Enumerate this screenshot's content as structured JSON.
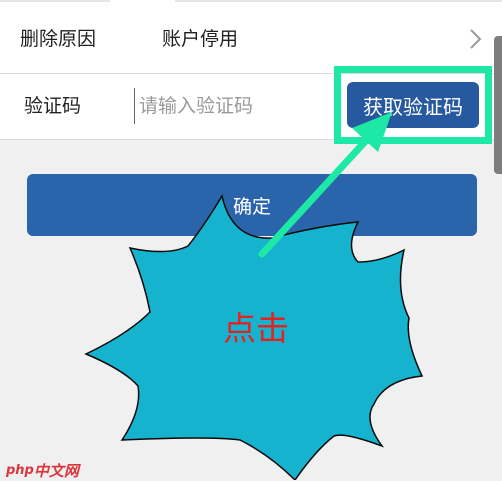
{
  "form": {
    "delete_reason_label": "删除原因",
    "delete_reason_value": "账户停用",
    "verification_label": "验证码",
    "verification_value": "",
    "verification_placeholder": "请输入验证码",
    "get_code_button": "获取验证码"
  },
  "confirm_button": "确定",
  "annotation": {
    "burst_text": "点击",
    "highlight_color": "#1ee8a6",
    "burst_fill": "#16b3cf",
    "burst_text_color": "#e32323"
  },
  "watermark": {
    "brand_left": "php",
    "brand_right": "中文网"
  },
  "colors": {
    "primary_button": "#2a64ab",
    "get_code_button": "#26599f"
  }
}
